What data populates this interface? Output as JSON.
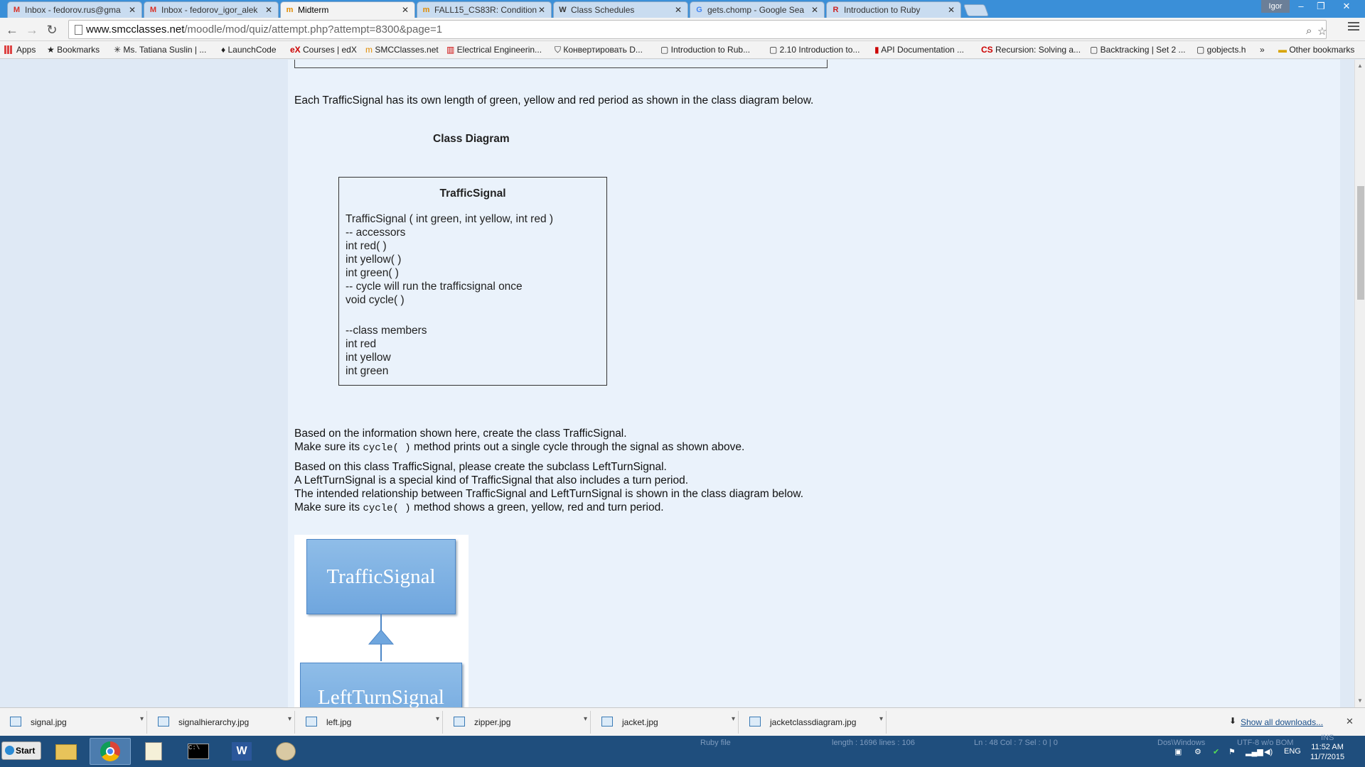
{
  "tabs": [
    {
      "label": "Inbox - fedorov.rus@gma",
      "favicon": "M"
    },
    {
      "label": "Inbox - fedorov_igor_alek",
      "favicon": "M"
    },
    {
      "label": "Midterm",
      "favicon": "m"
    },
    {
      "label": "FALL15_CS83R: Condition",
      "favicon": "m"
    },
    {
      "label": "Class Schedules",
      "favicon": "W"
    },
    {
      "label": "gets.chomp - Google Sea",
      "favicon": "G"
    },
    {
      "label": "Introduction to Ruby",
      "favicon": "R"
    }
  ],
  "user_badge": "Igor",
  "url": {
    "host": "www.smcclasses.net",
    "path": "/moodle/mod/quiz/attempt.php?attempt=8300&page=1"
  },
  "bookmarks": [
    "Apps",
    "Bookmarks",
    "Ms. Tatiana Suslin | ...",
    "LaunchCode",
    "Courses | edX",
    "SMCClasses.net",
    "Electrical Engineerin...",
    "Конвертировать D...",
    "Introduction to Rub...",
    "2.10 Introduction to...",
    "API Documentation ...",
    "Recursion: Solving a...",
    "Backtracking | Set 2 ...",
    "gobjects.h",
    "»",
    "Other bookmarks"
  ],
  "content": {
    "intro": "Each TrafficSignal has its own length of green, yellow and red period as shown in the class diagram below.",
    "diagram_title": "Class Diagram",
    "class_name": "TrafficSignal",
    "class_lines": [
      "TrafficSignal ( int green, int yellow, int red )",
      "-- accessors",
      "int red( )",
      "int yellow( )",
      "int green( )",
      "-- cycle will run the trafficsignal once",
      "void cycle( )",
      "",
      "--class members",
      "int red",
      "int yellow",
      "int green"
    ],
    "p1_line1": "Based on the information shown here, create the class TrafficSignal.",
    "p1_line2_pre": "Make sure its ",
    "p1_line2_code": "cycle( )",
    "p1_line2_post": " method prints out a single cycle through the signal as shown above.",
    "p2_line1": "Based on this class TrafficSignal, please create the subclass LeftTurnSignal.",
    "p2_line2": "A LeftTurnSignal is a special kind of TrafficSignal that also includes a turn period.",
    "p2_line3": "The intended relationship between TrafficSignal and LeftTurnSignal is shown in the class diagram below.",
    "p2_line4_pre": "Make sure its ",
    "p2_line4_code": "cycle( )",
    "p2_line4_post": " method shows a green, yellow, red and turn period.",
    "uml_parent": "TrafficSignal",
    "uml_child": "LeftTurnSignal"
  },
  "downloads": [
    "signal.jpg",
    "signalhierarchy.jpg",
    "left.jpg",
    "zipper.jpg",
    "jacket.jpg",
    "jacketclassdiagram.jpg"
  ],
  "show_all": "Show all downloads...",
  "taskbar": {
    "start": "Start",
    "status_file": "Ruby file",
    "status_length": "length : 1696    lines : 106",
    "status_pos": "Ln : 48    Col : 7    Sel : 0 | 0",
    "status_eol": "Dos\\Windows",
    "status_enc": "UTF-8 w/o BOM",
    "status_ins": "INS",
    "lang": "ENG",
    "time": "11:52 AM",
    "date": "11/7/2015"
  }
}
